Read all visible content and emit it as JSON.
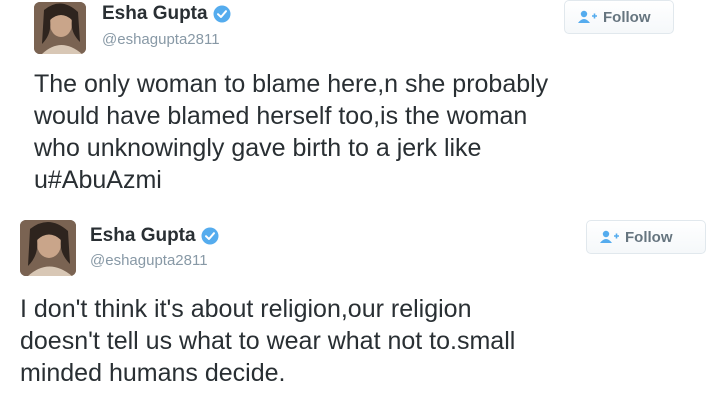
{
  "tweets": [
    {
      "author_name": "Esha Gupta",
      "handle": "@eshagupta2811",
      "follow_label": "Follow",
      "verified_icon": "verified-badge-icon",
      "follow_icon": "add-user-icon",
      "text": "The only woman to blame here,n she probably\nwould have blamed herself too,is the woman\nwho unknowingly gave birth to a jerk like\nu#AbuAzmi"
    },
    {
      "author_name": "Esha Gupta",
      "handle": "@eshagupta2811",
      "follow_label": "Follow",
      "verified_icon": "verified-badge-icon",
      "follow_icon": "add-user-icon",
      "text": "I don't think it's about religion,our religion\ndoesn't tell us what to wear what not to.small\nminded humans decide."
    }
  ],
  "colors": {
    "verified": "#55acee",
    "follow_text": "#66757f",
    "handle": "#8899a6",
    "text": "#292f33"
  }
}
